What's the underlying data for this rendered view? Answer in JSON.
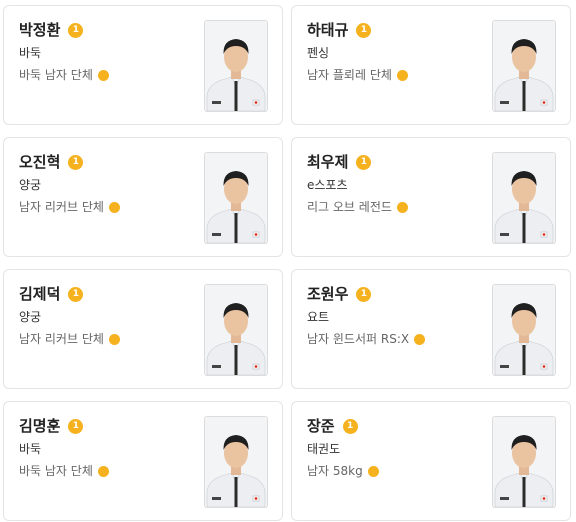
{
  "athletes": [
    {
      "name": "박정환",
      "medal": "1",
      "sport": "바둑",
      "event": "바둑 남자 단체"
    },
    {
      "name": "하태규",
      "medal": "1",
      "sport": "펜싱",
      "event": "남자 플뢰레 단체"
    },
    {
      "name": "오진혁",
      "medal": "1",
      "sport": "양궁",
      "event": "남자 리커브 단체"
    },
    {
      "name": "최우제",
      "medal": "1",
      "sport": "e스포츠",
      "event": "리그 오브 레전드"
    },
    {
      "name": "김제덕",
      "medal": "1",
      "sport": "양궁",
      "event": "남자 리커브 단체"
    },
    {
      "name": "조원우",
      "medal": "1",
      "sport": "요트",
      "event": "남자 윈드서퍼 RS:X"
    },
    {
      "name": "김명훈",
      "medal": "1",
      "sport": "바둑",
      "event": "바둑 남자 단체"
    },
    {
      "name": "장준",
      "medal": "1",
      "sport": "태권도",
      "event": "남자 58kg"
    }
  ],
  "colors": {
    "gold_medal": "#f5b21e",
    "card_border": "#e4e4e4"
  },
  "icons": {
    "medal": "gold-medal-icon",
    "event_marker": "gold-dot-icon"
  }
}
